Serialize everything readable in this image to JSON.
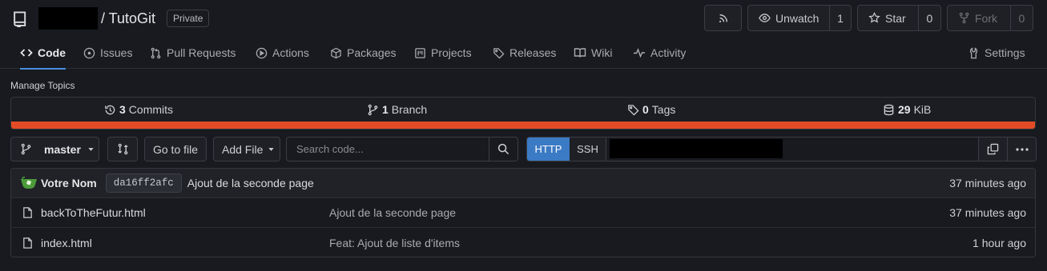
{
  "repo": {
    "name": "/ TutoGit",
    "visibility": "Private"
  },
  "actions": {
    "rss_icon": "rss-icon",
    "watch_label": "Unwatch",
    "watch_count": "1",
    "star_label": "Star",
    "star_count": "0",
    "fork_label": "Fork",
    "fork_count": "0"
  },
  "tabs": [
    {
      "label": "Code",
      "icon": "code-icon",
      "active": true
    },
    {
      "label": "Issues",
      "icon": "issue-icon"
    },
    {
      "label": "Pull Requests",
      "icon": "pull-request-icon"
    },
    {
      "label": "Actions",
      "icon": "play-icon"
    },
    {
      "label": "Packages",
      "icon": "package-icon"
    },
    {
      "label": "Projects",
      "icon": "project-icon"
    },
    {
      "label": "Releases",
      "icon": "tag-icon"
    },
    {
      "label": "Wiki",
      "icon": "book-icon"
    },
    {
      "label": "Activity",
      "icon": "pulse-icon"
    }
  ],
  "settings_label": "Settings",
  "manage_topics": "Manage Topics",
  "stats": {
    "commits_count": "3",
    "commits_label": "Commits",
    "branch_count": "1",
    "branch_label": "Branch",
    "tags_count": "0",
    "tags_label": "Tags",
    "size_value": "29",
    "size_unit": "KiB",
    "language_color": "#e34c26"
  },
  "toolbar": {
    "branch": "master",
    "goto_file": "Go to file",
    "add_file": "Add File",
    "search_placeholder": "Search code...",
    "http": "HTTP",
    "ssh": "SSH"
  },
  "latest_commit": {
    "author": "Votre Nom",
    "sha": "da16ff2afc",
    "message": "Ajout de la seconde page",
    "time": "37 minutes ago"
  },
  "files": [
    {
      "name": "backToTheFutur.html",
      "message": "Ajout de la seconde page",
      "time": "37 minutes ago"
    },
    {
      "name": "index.html",
      "message": "Feat: Ajout de liste d'items",
      "time": "1 hour ago"
    }
  ]
}
